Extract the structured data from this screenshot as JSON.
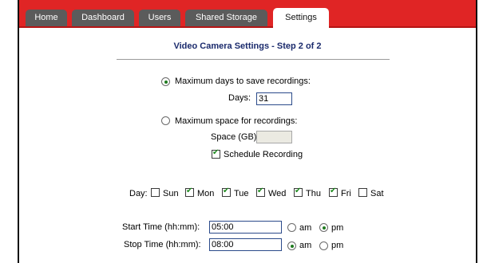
{
  "tabs": [
    {
      "label": "Home"
    },
    {
      "label": "Dashboard"
    },
    {
      "label": "Users"
    },
    {
      "label": "Shared Storage"
    },
    {
      "label": "Settings"
    }
  ],
  "active_tab": "Settings",
  "page_title": "Video Camera Settings - Step 2 of 2",
  "limits": {
    "max_days_label": "Maximum days to save recordings:",
    "days_label": "Days:",
    "days_value": "31",
    "max_days_selected": true,
    "max_space_label": "Maximum space for recordings:",
    "space_label": "Space (GB):",
    "space_value": "",
    "max_space_selected": false
  },
  "schedule": {
    "label": "Schedule Recording",
    "checked": true
  },
  "days": {
    "label": "Day:",
    "items": [
      {
        "label": "Sun",
        "checked": false
      },
      {
        "label": "Mon",
        "checked": true
      },
      {
        "label": "Tue",
        "checked": true
      },
      {
        "label": "Wed",
        "checked": true
      },
      {
        "label": "Thu",
        "checked": true
      },
      {
        "label": "Fri",
        "checked": true
      },
      {
        "label": "Sat",
        "checked": false
      }
    ]
  },
  "times": {
    "start_label": "Start Time (hh:mm):",
    "start_value": "05:00",
    "start_period": "pm",
    "stop_label": "Stop Time (hh:mm):",
    "stop_value": "08:00",
    "stop_period": "am",
    "am_label": "am",
    "pm_label": "pm"
  }
}
